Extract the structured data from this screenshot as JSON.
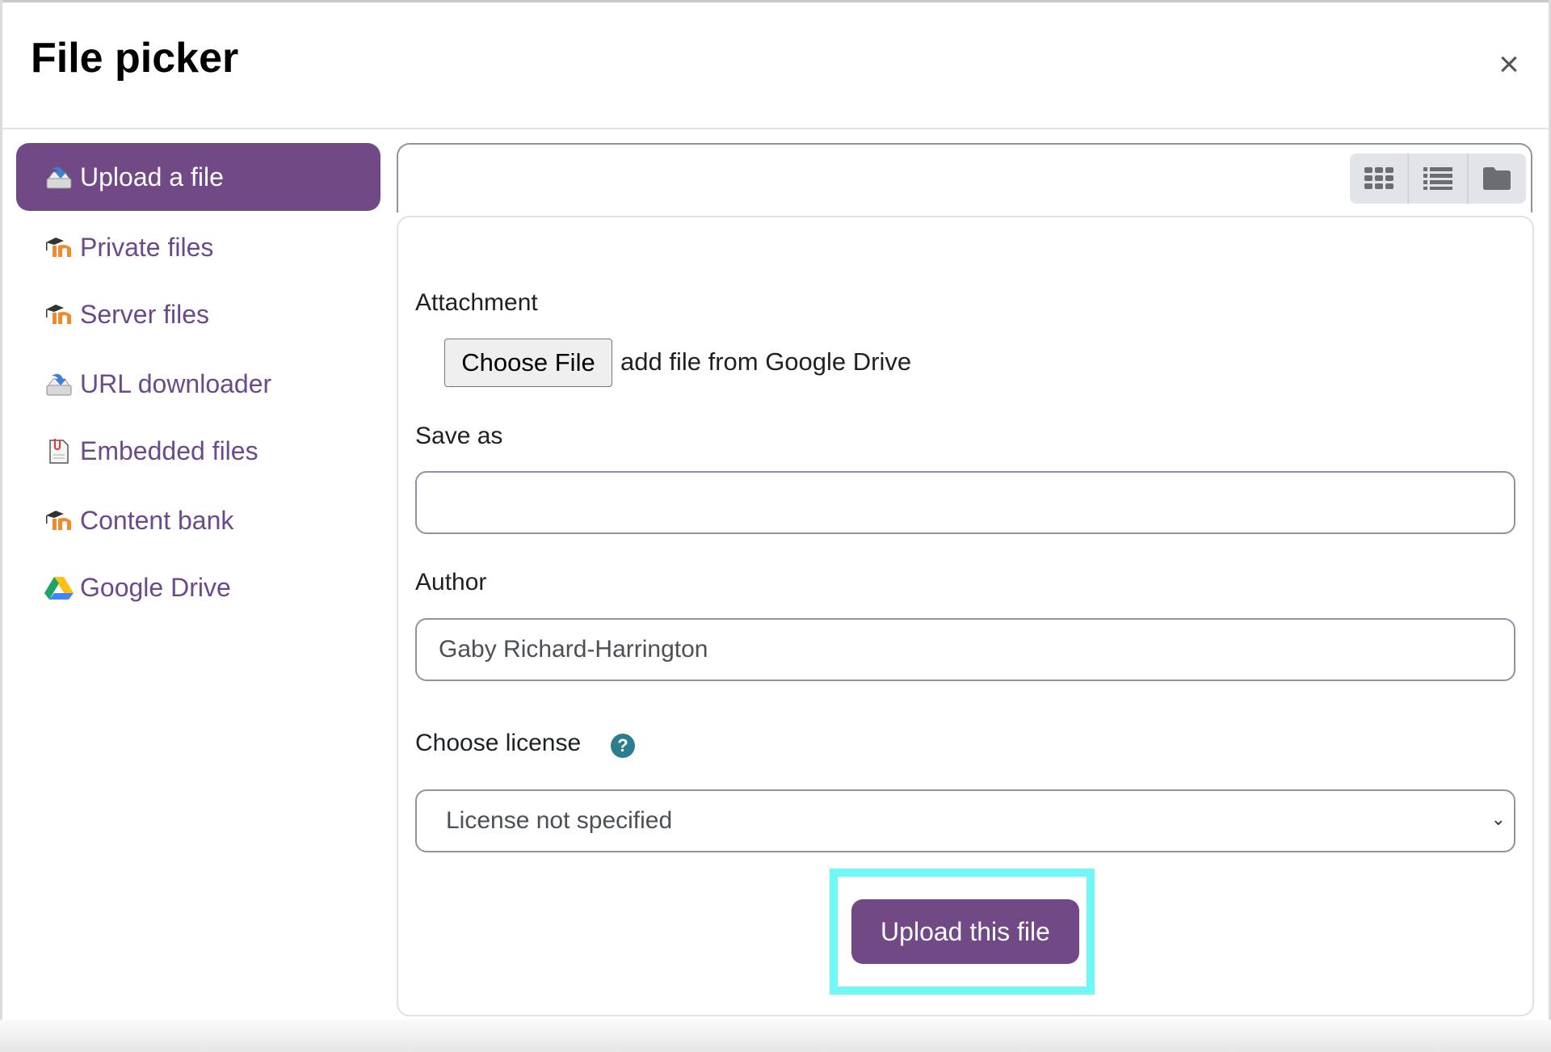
{
  "dialog": {
    "title": "File picker",
    "close_icon": "close-icon"
  },
  "sidebar": {
    "items": [
      {
        "label": "Upload a file",
        "icon": "upload-icon",
        "active": true
      },
      {
        "label": "Private files",
        "icon": "moodle-icon"
      },
      {
        "label": "Server files",
        "icon": "moodle-icon"
      },
      {
        "label": "URL downloader",
        "icon": "download-icon"
      },
      {
        "label": "Embedded files",
        "icon": "document-icon"
      },
      {
        "label": "Content bank",
        "icon": "moodle-icon"
      },
      {
        "label": "Google Drive",
        "icon": "google-drive-icon"
      }
    ]
  },
  "toolbar": {
    "views": [
      "grid-icon",
      "list-icon",
      "folder-icon"
    ]
  },
  "form": {
    "attachment_label": "Attachment",
    "choose_file_label": "Choose File",
    "file_status": "add file from Google Drive",
    "save_as_label": "Save as",
    "save_as_value": "",
    "author_label": "Author",
    "author_value": "Gaby Richard-Harrington",
    "license_label": "Choose license",
    "license_value": "License not specified",
    "submit_label": "Upload this file"
  },
  "colors": {
    "accent": "#714987",
    "link": "#6a4a8c",
    "help": "#2b7e8d",
    "highlight": "#6ff8f8"
  }
}
